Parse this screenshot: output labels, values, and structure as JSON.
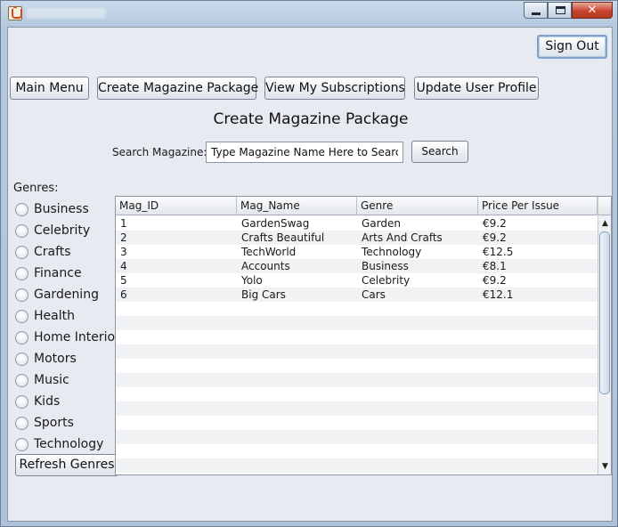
{
  "nav": {
    "sign_out": "Sign Out",
    "main_menu": "Main Menu",
    "create_package": "Create Magazine Package",
    "view_subscriptions": "View My Subscriptions",
    "update_profile": "Update User Profile"
  },
  "page": {
    "heading": "Create Magazine Package"
  },
  "search": {
    "label": "Search Magazine:",
    "value": "Type Magazine Name Here to Search",
    "button": "Search"
  },
  "genres": {
    "label": "Genres:",
    "items": [
      "Business",
      "Celebrity",
      "Crafts",
      "Finance",
      "Gardening",
      "Health",
      "Home Interiors",
      "Motors",
      "Music",
      "Kids",
      "Sports",
      "Technology"
    ],
    "refresh": "Refresh Genres"
  },
  "table": {
    "columns": [
      "Mag_ID",
      "Mag_Name",
      "Genre",
      "Price Per Issue"
    ],
    "rows": [
      [
        "1",
        "GardenSwag",
        "Garden",
        "€9.2"
      ],
      [
        "2",
        "Crafts Beautiful",
        "Arts And Crafts",
        "€9.2"
      ],
      [
        "3",
        "TechWorld",
        "Technology",
        "€12.5"
      ],
      [
        "4",
        "Accounts",
        "Business",
        "€8.1"
      ],
      [
        "5",
        "Yolo",
        "Celebrity",
        "€9.2"
      ],
      [
        "6",
        "Big Cars",
        "Cars",
        "€12.1"
      ]
    ]
  },
  "window": {
    "minimize_icon": "minimize-icon",
    "maximize_icon": "maximize-icon",
    "close_icon": "close-icon",
    "close_glyph": "✕"
  }
}
